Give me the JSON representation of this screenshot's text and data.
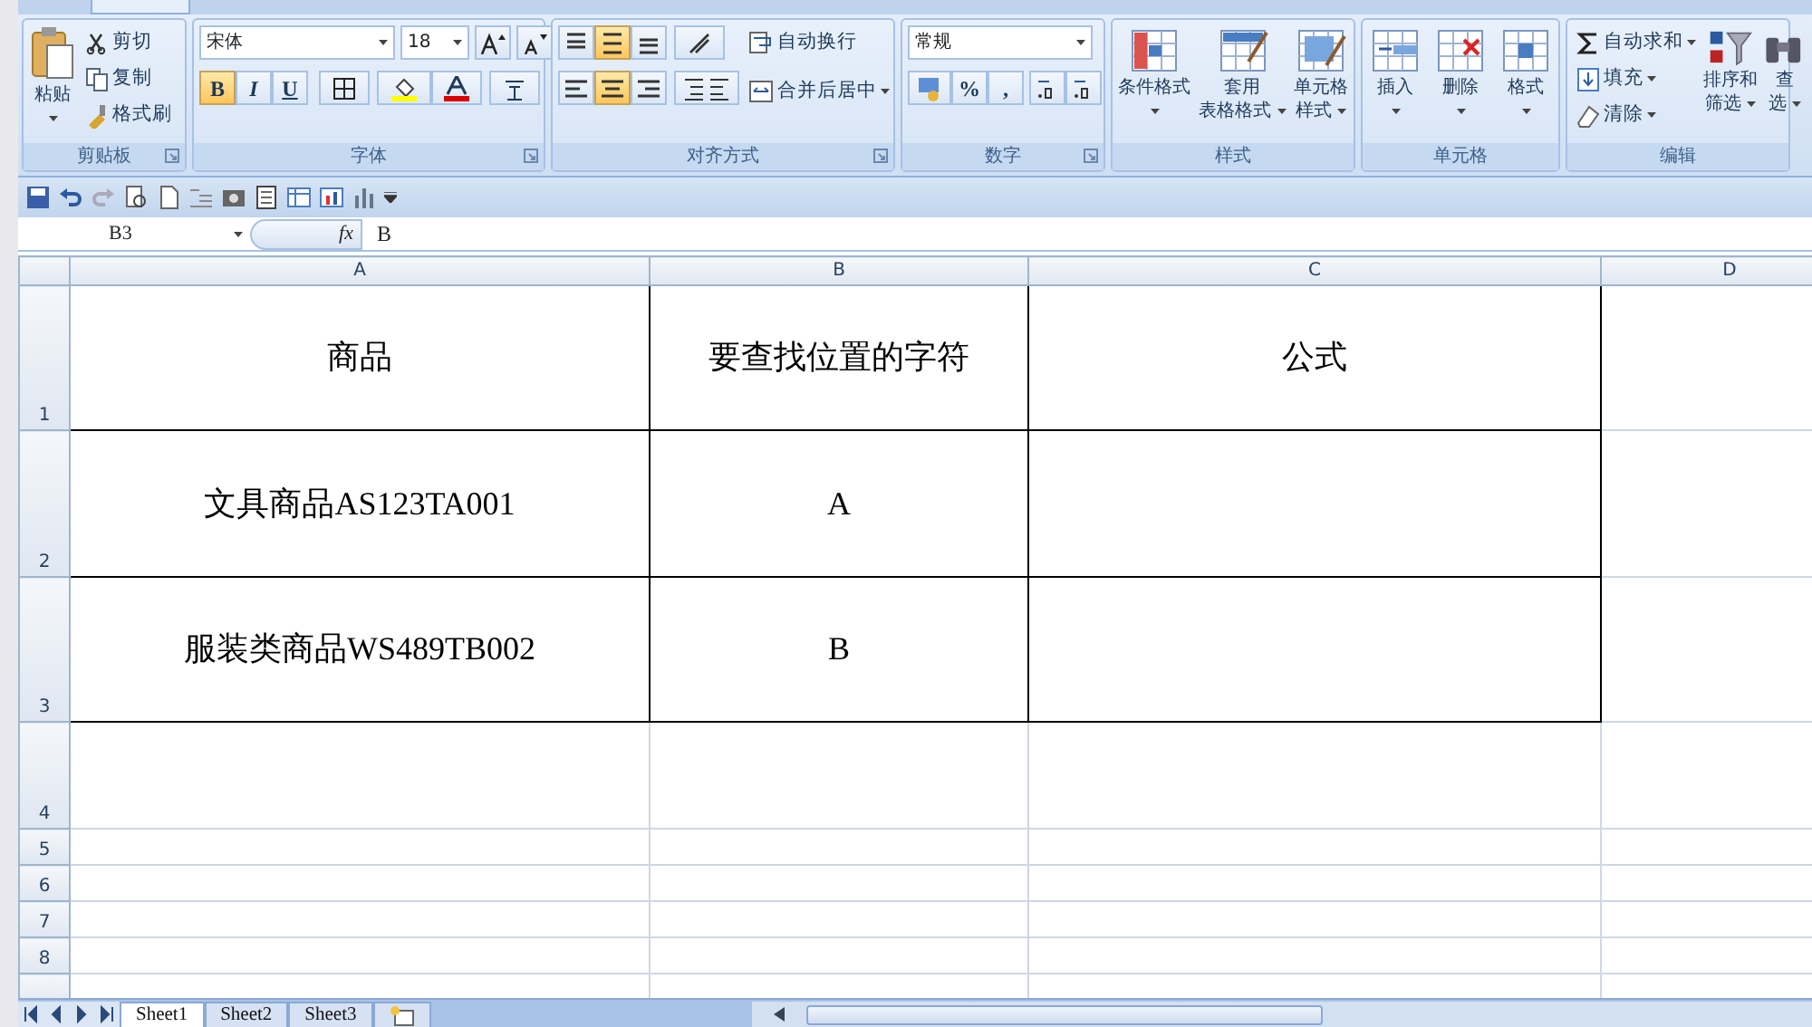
{
  "ribbon": {
    "groups": [
      {
        "kind": "clipboard",
        "label": "剪贴板",
        "paste": "粘贴",
        "small": [
          "剪切",
          "复制",
          "格式刷"
        ]
      },
      {
        "kind": "font",
        "label": "字体",
        "font_name": "宋体",
        "font_size": "18",
        "format_buttons": [
          {
            "label": "B",
            "selected": true
          },
          {
            "label": "I",
            "selected": false
          },
          {
            "label": "U",
            "selected": false
          }
        ]
      },
      {
        "kind": "alignment",
        "label": "对齐方式",
        "vertical_align": [
          {
            "selected": false
          },
          {
            "selected": true
          },
          {
            "selected": false
          }
        ],
        "horizontal_align": [
          {
            "selected": false
          },
          {
            "selected": true
          },
          {
            "selected": false
          }
        ],
        "wrap_text": "自动换行",
        "merge": "合并后居中"
      },
      {
        "kind": "number",
        "label": "数字",
        "format": "常规",
        "buttons": [
          "%",
          ","
        ]
      },
      {
        "kind": "styles",
        "label": "样式",
        "large": [
          [
            "条件格式"
          ],
          [
            "套用",
            "表格格式"
          ],
          [
            "单元格",
            "样式"
          ]
        ]
      },
      {
        "kind": "cells",
        "label": "单元格",
        "large": [
          [
            "插入"
          ],
          [
            "删除"
          ],
          [
            "格式"
          ]
        ]
      },
      {
        "kind": "editing",
        "label": "编辑",
        "small": [
          "自动求和",
          "填充",
          "清除"
        ],
        "large": [
          [
            "排序和",
            "筛选"
          ],
          [
            "查",
            "选"
          ]
        ]
      }
    ]
  },
  "formula_bar": {
    "name_box": "B3",
    "function_label": "fx",
    "formula": "B"
  },
  "sheet": {
    "columns": [
      "A",
      "B",
      "C",
      "D"
    ],
    "rows": [
      {
        "header": "1",
        "cells": [
          "商品",
          "要查找位置的字符",
          "公式",
          ""
        ]
      },
      {
        "header": "2",
        "cells": [
          "文具商品AS123TA001",
          "A",
          "",
          ""
        ]
      },
      {
        "header": "3",
        "cells": [
          "服装类商品WS489TB002",
          "B",
          "",
          ""
        ]
      },
      {
        "header": "4",
        "cells": [
          "",
          "",
          "",
          ""
        ]
      },
      {
        "header": "5",
        "cells": [
          "",
          "",
          "",
          ""
        ]
      },
      {
        "header": "6",
        "cells": [
          "",
          "",
          "",
          ""
        ]
      },
      {
        "header": "7",
        "cells": [
          "",
          "",
          "",
          ""
        ]
      },
      {
        "header": "8",
        "cells": [
          "",
          "",
          "",
          ""
        ]
      },
      {
        "cells": [
          "",
          "",
          "",
          ""
        ]
      }
    ]
  },
  "sheet_tabs": [
    {
      "label": "Sheet1",
      "selected": true
    },
    {
      "label": "Sheet2",
      "selected": false
    },
    {
      "label": "Sheet3",
      "selected": false
    }
  ]
}
